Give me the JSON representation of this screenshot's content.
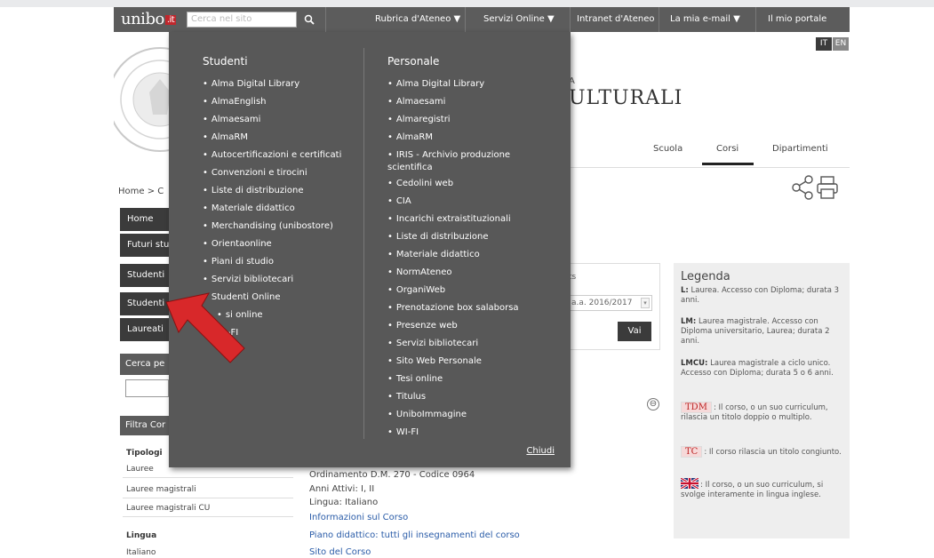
{
  "topbar": {
    "logo_text": "unibo",
    "logo_suffix": ".it",
    "search_placeholder": "Cerca nel sito",
    "search_icon": "search-icon",
    "nav": [
      {
        "label": "Rubrica d'Ateneo ▼"
      },
      {
        "label": "Servizi Online ▼"
      },
      {
        "label": "Intranet d'Ateneo"
      },
      {
        "label": "La mia e-mail ▼"
      },
      {
        "label": "Il mio portale"
      }
    ]
  },
  "header": {
    "title_fragment": "ULTURALI",
    "small_fragment": "A",
    "lang_it": "IT",
    "lang_en": "EN"
  },
  "tabs": [
    {
      "label": "Scuola"
    },
    {
      "label": "Corsi"
    },
    {
      "label": "Dipartimenti"
    }
  ],
  "breadcrumb": "Home > C",
  "left_nav": [
    {
      "label": "Home"
    },
    {
      "label": "Futuri stu"
    },
    {
      "label": "Studenti"
    },
    {
      "label": "Studenti"
    },
    {
      "label": "Laureati"
    }
  ],
  "left_search_title": "Cerca pe",
  "filter": {
    "title": "Filtra Cor",
    "tipologia_head": "Tipologi",
    "tipologia": [
      "Lauree",
      "Lauree magistrali",
      "Lauree magistrali CU"
    ],
    "lingua_head": "Lingua",
    "lingua": [
      "Italiano"
    ]
  },
  "center": {
    "dots_text": "ts",
    "select_value": "a.a. 2016/2017",
    "go_button": "Vai",
    "collapse_symbol": "⊖",
    "course_lines": [
      "Ordinamento D.M. 270 - Codice 0964",
      "Anni Attivi: I, II",
      "Lingua: Italiano"
    ],
    "course_links": [
      "Informazioni sul Corso",
      "Piano didattico: tutti gli insegnamenti del corso",
      "Sito del Corso"
    ]
  },
  "legend": {
    "title": "Legenda",
    "items": [
      {
        "key": "L:",
        "text": "Laurea. Accesso con Diploma; durata 3 anni."
      },
      {
        "key": "LM:",
        "text": "Laurea magistrale. Accesso con Diploma universitario, Laurea; durata 2 anni."
      },
      {
        "key": "LMCU:",
        "text": "Laurea magistrale a ciclo unico. Accesso con Diploma; durata 5 o 6 anni."
      }
    ],
    "tdm_tag": "TDM",
    "tdm_text": ": Il corso, o un suo curriculum, rilascia un titolo doppio o multiplo.",
    "tc_tag": "TC",
    "tc_text": ": Il corso rilascia un titolo congiunto.",
    "flag_text": ": Il corso, o un suo curriculum, si svolge interamente in lingua inglese."
  },
  "dropdown": {
    "studenti_head": "Studenti",
    "studenti": [
      "Alma Digital Library",
      "AlmaEnglish",
      "Almaesami",
      "AlmaRM",
      "Autocertificazioni e certificati",
      "Convenzioni e tirocini",
      "Liste di distribuzione",
      "Materiale didattico",
      "Merchandising (unibostore)",
      "Orientaonline",
      "Piani di studio",
      "Servizi bibliotecari",
      "Studenti Online",
      "si online",
      "-FI"
    ],
    "personale_head": "Personale",
    "personale": [
      "Alma Digital Library",
      "Almaesami",
      "Almaregistri",
      "AlmaRM",
      "IRIS - Archivio produzione scientifica",
      "Cedolini web",
      "CIA",
      "Incarichi extraistituzionali",
      "Liste di distribuzione",
      "Materiale didattico",
      "NormAteneo",
      "OrganiWeb",
      "Prenotazione box salaborsa",
      "Presenze web",
      "Servizi bibliotecari",
      "Sito Web Personale",
      "Tesi online",
      "Titulus",
      "UniboImmagine",
      "WI-FI"
    ],
    "close_label": "Chiudi"
  },
  "colors": {
    "topbar": "#5c5c5c",
    "dropdown": "#585858",
    "arrow": "#d8282a",
    "link": "#2a5ca8"
  }
}
